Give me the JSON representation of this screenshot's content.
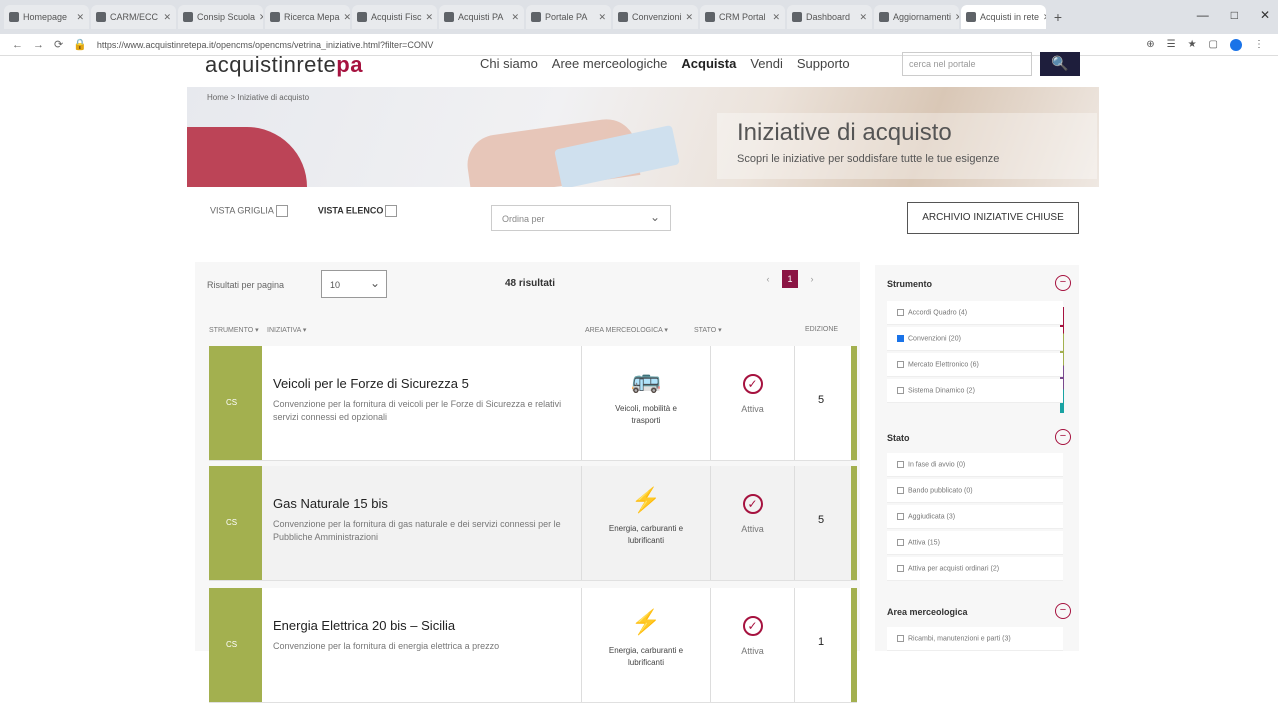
{
  "browser": {
    "tabs": [
      "Homepage",
      "CARM/ECC",
      "Consip Scuola",
      "Ricerca Mepa",
      "Acquisti Fisc",
      "Acquisti PA",
      "Portale PA",
      "Convenzioni",
      "CRM Portal",
      "Dashboard",
      "Aggiornamenti",
      "Acquisti in rete"
    ],
    "url": "https://www.acquistinretepa.it/opencms/opencms/vetrina_iniziative.html?filter=CONV",
    "window_controls": [
      "—",
      "□",
      "✕"
    ],
    "new_tab": "+"
  },
  "header": {
    "logo_pre": "acquistinrete",
    "logo_brand": "pa",
    "nav": [
      "Chi siamo",
      "Aree merceologiche",
      "Acquista",
      "Vendi",
      "Supporto"
    ],
    "search_placeholder": "cerca nel portale",
    "search_icon": "🔍"
  },
  "hero": {
    "breadcrumb": "Home > Iniziative di acquisto",
    "title": "Iniziative di acquisto",
    "subtitle": "Scopri le iniziative per soddisfare tutte le tue esigenze"
  },
  "toolbar": {
    "view_grid": "VISTA GRIGLIA",
    "view_list": "VISTA ELENCO",
    "sort_placeholder": "Ordina per",
    "archive_button": "ARCHIVIO INIZIATIVE CHIUSE"
  },
  "list": {
    "per_page_label": "Risultati per pagina",
    "per_page_value": "10",
    "results": "48 risultati",
    "pager": [
      "‹",
      "1",
      "›"
    ],
    "columns": [
      "STRUMENTO ▾",
      "INIZIATIVA ▾",
      "AREA MERCEOLOGICA ▾",
      "STATO ▾",
      "EDIZIONE"
    ],
    "rows": [
      {
        "badge": "CS",
        "title": "Veicoli per le Forze di Sicurezza 5",
        "desc": "Convenzione per la fornitura di veicoli per le Forze di Sicurezza e relativi servizi connessi ed opzionali",
        "category": "Veicoli, mobilità e trasporti",
        "status": "Attiva",
        "edition": "5"
      },
      {
        "badge": "CS",
        "title": "Gas Naturale 15 bis",
        "desc": "Convenzione per la fornitura di gas naturale e dei servizi connessi per le Pubbliche Amministrazioni",
        "category": "Energia, carburanti e lubrificanti",
        "status": "Attiva",
        "edition": "5"
      },
      {
        "badge": "CS",
        "title": "Energia Elettrica 20 bis – Sicilia",
        "desc": "Convenzione per la fornitura di energia elettrica a prezzo",
        "category": "Energia, carburanti e lubrificanti",
        "status": "Attiva",
        "edition": "1"
      }
    ]
  },
  "sidebar": {
    "sections": [
      {
        "title": "Strumento",
        "toggle": "−",
        "options": [
          {
            "label": "Accordi Quadro (4)",
            "checked": false
          },
          {
            "label": "Convenzioni (20)",
            "checked": true
          },
          {
            "label": "Mercato Elettronico (6)",
            "checked": false
          },
          {
            "label": "Sistema Dinamico (2)",
            "checked": false
          }
        ]
      },
      {
        "title": "Stato",
        "toggle": "−",
        "options": [
          {
            "label": "In fase di avvio (0)",
            "checked": false
          },
          {
            "label": "Bando pubblicato (0)",
            "checked": false
          },
          {
            "label": "Aggiudicata (3)",
            "checked": false
          },
          {
            "label": "Attiva (15)",
            "checked": false
          },
          {
            "label": "Attiva per acquisti ordinari (2)",
            "checked": false
          }
        ]
      },
      {
        "title": "Area merceologica",
        "toggle": "−",
        "options": [
          {
            "label": "Ricambi, manutenzioni e parti (3)",
            "checked": false
          }
        ]
      }
    ]
  },
  "colors": {
    "brand": "#a6123f",
    "stripe": "#a3b04f",
    "search_btn": "#1e1e3c"
  }
}
